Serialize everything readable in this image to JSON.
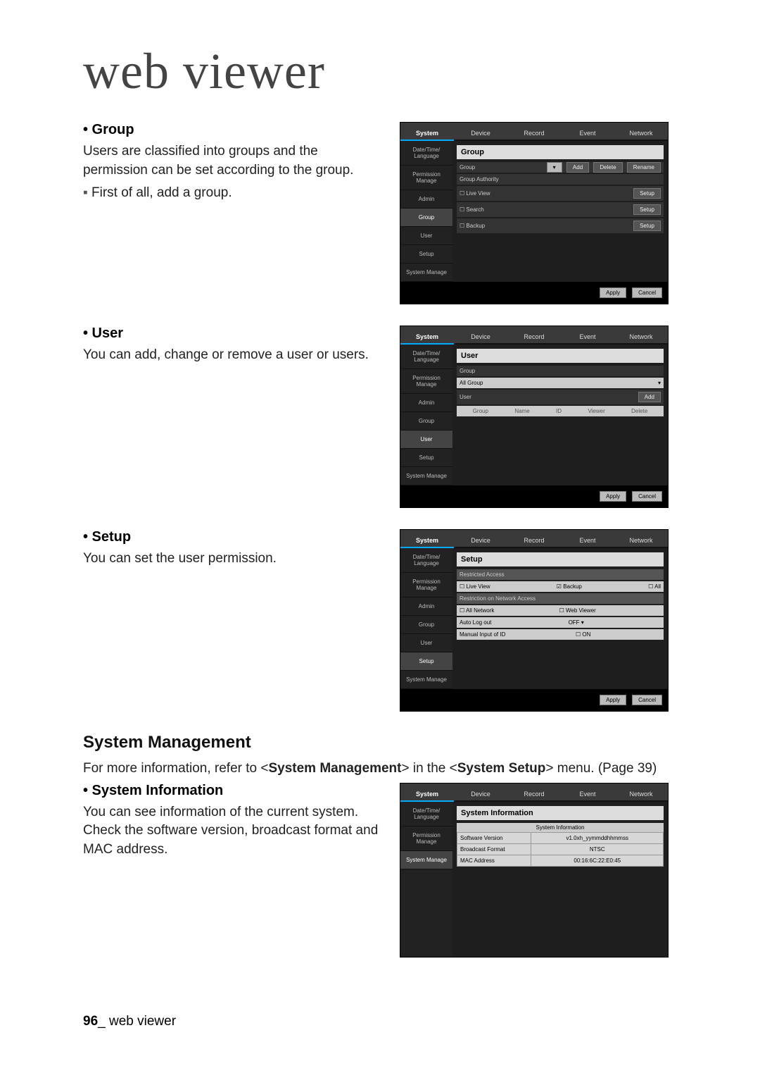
{
  "title": "web viewer",
  "footer": {
    "page": "96",
    "label": "web viewer"
  },
  "sec_group": {
    "heading": "• Group",
    "p1": "Users are classified into groups and the permission can be set according to the group.",
    "p2": "First of all, add a group."
  },
  "sec_user": {
    "heading": "• User",
    "p1": "You can add, change or remove a user or users."
  },
  "sec_setup": {
    "heading": "• Setup",
    "p1": "You can set the user permission."
  },
  "sm": {
    "heading": "System Management",
    "p1a": "For more information, refer to <",
    "p1b": "System Management",
    "p1c": "> in the <",
    "p1d": "System Setup",
    "p1e": "> menu. (Page 39)"
  },
  "sec_sysinfo": {
    "heading": "• System Information",
    "p1": "You can see information of the current system. Check the software version, broadcast format and MAC address."
  },
  "tabs": {
    "system": "System",
    "device": "Device",
    "record": "Record",
    "event": "Event",
    "network": "Network"
  },
  "side": {
    "dtl": "Date/Time/\nLanguage",
    "perm": "Permission\nManage",
    "admin": "Admin",
    "group": "Group",
    "user": "User",
    "setup": "Setup",
    "sys": "System\nManage"
  },
  "shot_group": {
    "panel_title": "Group",
    "bar_label": "Group",
    "btn_add": "Add",
    "btn_delete": "Delete",
    "btn_rename": "Rename",
    "ga_label": "Group Authority",
    "rows": [
      "Live View",
      "Search",
      "Backup"
    ],
    "row_btn": "Setup",
    "apply": "Apply",
    "cancel": "Cancel"
  },
  "shot_user": {
    "panel_title": "User",
    "group_lbl": "Group",
    "group_val": "All Group",
    "user_bar": "User",
    "btn_add": "Add",
    "cols": [
      "Group",
      "Name",
      "ID",
      "Viewer",
      "Delete"
    ],
    "apply": "Apply",
    "cancel": "Cancel"
  },
  "shot_setup": {
    "panel_title": "Setup",
    "ra": "Restricted Access",
    "lv": "Live View",
    "bk": "Backup",
    "all": "All",
    "rna": "Restriction on Network Access",
    "an": "All Network",
    "wv": "Web Viewer",
    "alo": "Auto Log out",
    "alo_val": "OFF",
    "mid": "Manual Input of ID",
    "mid_val": "ON",
    "apply": "Apply",
    "cancel": "Cancel"
  },
  "shot_sysinfo": {
    "panel_title": "System Information",
    "block_title": "System Information",
    "rows": [
      {
        "k": "Software Version",
        "v": "v1.0xh_yymmddhhmmss"
      },
      {
        "k": "Broadcast Format",
        "v": "NTSC"
      },
      {
        "k": "MAC Address",
        "v": "00:16:6C:22:E0:45"
      }
    ]
  }
}
